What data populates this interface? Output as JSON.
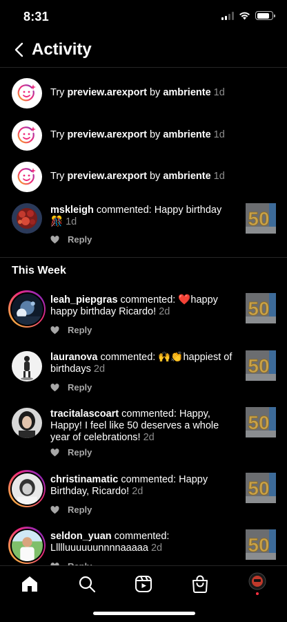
{
  "status_bar": {
    "time": "8:31",
    "battery_level": 0.85
  },
  "header": {
    "title": "Activity"
  },
  "ar_notifications": [
    {
      "prefix": "Try ",
      "effect": "preview.arexport",
      "by": " by ",
      "author": "ambriente",
      "time": "1d"
    },
    {
      "prefix": "Try ",
      "effect": "preview.arexport",
      "by": " by ",
      "author": "ambriente",
      "time": "1d"
    },
    {
      "prefix": "Try ",
      "effect": "preview.arexport",
      "by": " by ",
      "author": "ambriente",
      "time": "1d"
    }
  ],
  "earlier_comment": {
    "username": "mskleigh",
    "action": " commented: Happy birthday",
    "emoji": "🎊",
    "time": "1d",
    "reply_label": "Reply"
  },
  "section": {
    "title": "This Week"
  },
  "week_comments": [
    {
      "username": "leah_piepgras",
      "action": " commented: ",
      "emoji": "❤️",
      "text": "happy happy birthday Ricardo!",
      "time": "2d",
      "reply_label": "Reply"
    },
    {
      "username": "lauranova",
      "action": " commented: ",
      "emoji": "🙌👏",
      "text": "happiest of birthdays",
      "time": "2d",
      "reply_label": "Reply"
    },
    {
      "username": "tracitalascoart",
      "action": " commented: Happy, Happy!  I feel like 50 deserves a whole year of celebrations!",
      "emoji": "",
      "text": "",
      "time": "2d",
      "reply_label": "Reply"
    },
    {
      "username": "christinamatic",
      "action": " commented: Happy Birthday, Ricardo!",
      "emoji": "",
      "text": "",
      "time": "2d",
      "reply_label": "Reply"
    },
    {
      "username": "seldon_yuan",
      "action": " commented: Llllluuuuuunnnnaaaaa",
      "emoji": "",
      "text": "",
      "time": "2d",
      "reply_label": "Reply"
    }
  ],
  "thumbnail": {
    "label": "50"
  },
  "nav": {
    "items": [
      "home-icon",
      "search-icon",
      "reels-icon",
      "shop-icon",
      "profile-avatar"
    ]
  },
  "colors": {
    "background": "#000000",
    "muted": "#8e8e8e",
    "divider": "#262626",
    "balloon_gold": "#c9a24a"
  }
}
